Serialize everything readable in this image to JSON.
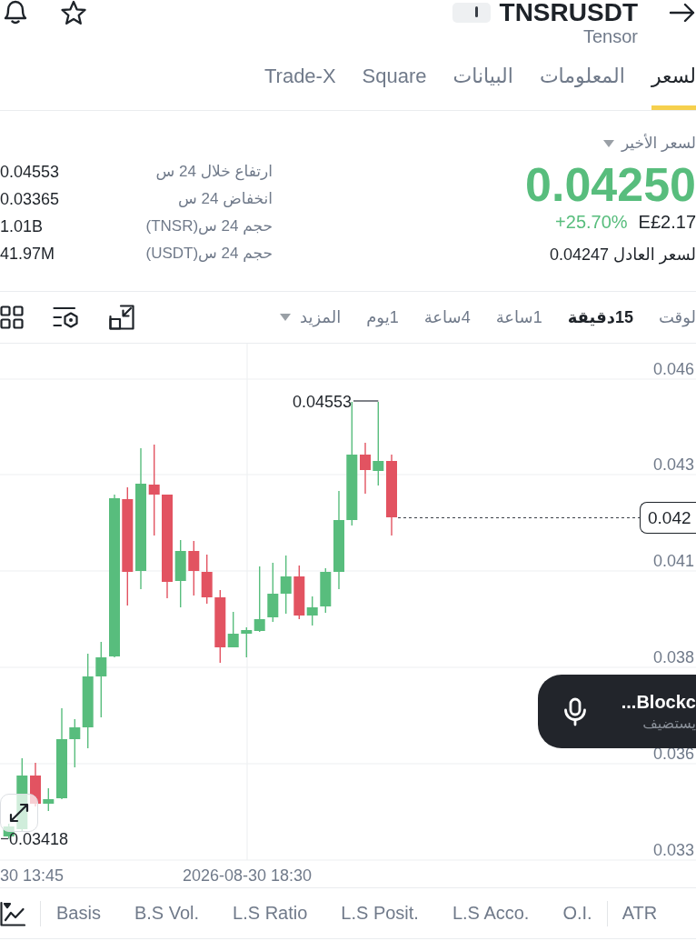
{
  "header": {
    "title": "TNSRUSDT",
    "subtitle": "Tensor"
  },
  "tabs": [
    {
      "label": "لسعر",
      "selected": true
    },
    {
      "label": "المعلومات",
      "selected": false
    },
    {
      "label": "البيانات",
      "selected": false
    },
    {
      "label": "Square",
      "selected": false
    },
    {
      "label": "Trade-X",
      "selected": false
    }
  ],
  "price": {
    "label": "لسعر الأخير",
    "last": "0.04250",
    "fiat": "E£2.17",
    "change": "+25.70%",
    "fair_price": "لسعر العادل 0.04247"
  },
  "stats": [
    {
      "label": "ارتفاع خلال 24 س",
      "value": "0.04553"
    },
    {
      "label": "انخفاض 24 س",
      "value": "0.03365"
    },
    {
      "label": "حجم 24 س(TNSR)",
      "value": "1.01B"
    },
    {
      "label": "حجم 24 س(USDT)",
      "value": "41.97M"
    }
  ],
  "interval_bar": {
    "label": "لوقت",
    "intervals": [
      {
        "label": "15دقيقة",
        "selected": true
      },
      {
        "label": "1ساعة",
        "selected": false
      },
      {
        "label": "4ساعة",
        "selected": false
      },
      {
        "label": "1يوم",
        "selected": false
      }
    ],
    "more": "المزيد"
  },
  "chart": {
    "y_axis": [
      "0.046",
      "0.043",
      "0.041",
      "0.038",
      "0.036",
      "0.033"
    ],
    "x_axis": [
      "2026-08-30 18:30",
      "30 13:45"
    ],
    "high_label": "0.04553",
    "low_label": "0.03418",
    "price_tag": "0.042"
  },
  "audio_banner": {
    "title": "Blockc...",
    "subtitle": "يستضيف"
  },
  "indicator_groups": [
    {
      "items": [
        "ATR"
      ]
    },
    {
      "items": [
        "O.I.",
        "L.S Acco.",
        "L.S Posit.",
        "L.S Ratio",
        "B.S Vol.",
        "Basis"
      ]
    }
  ]
}
